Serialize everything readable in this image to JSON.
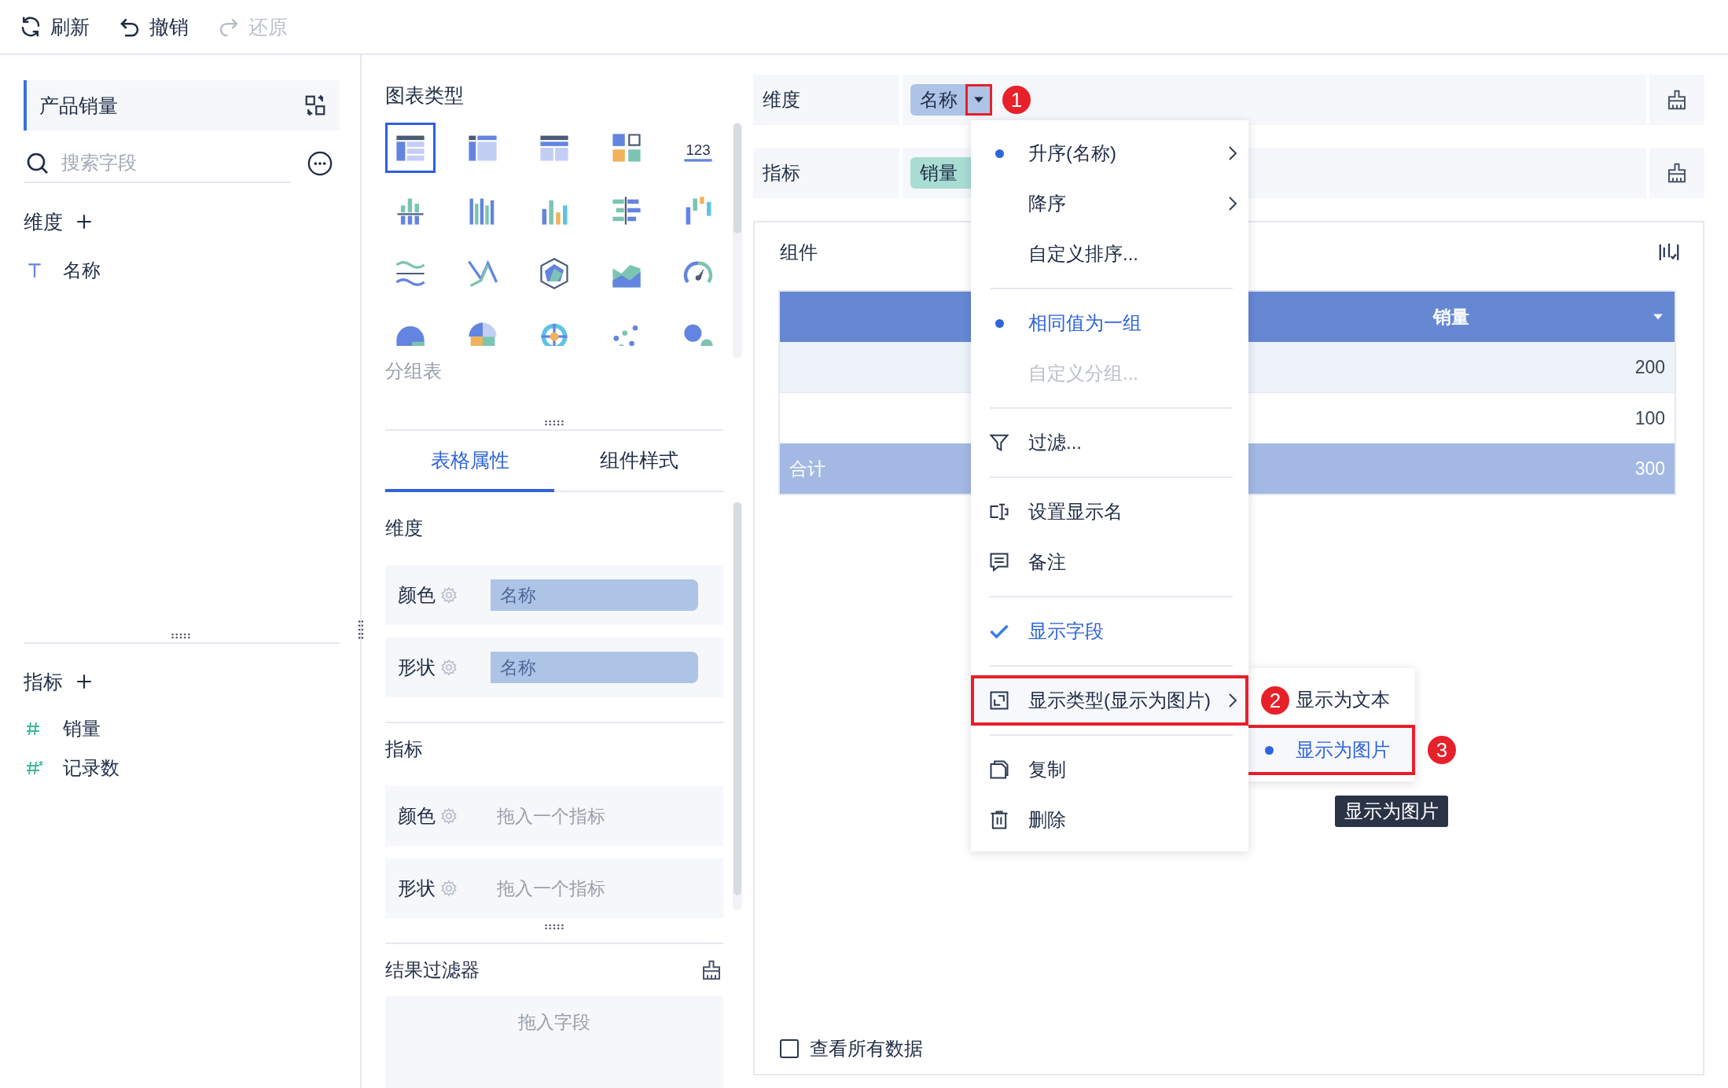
{
  "toolbar": [
    {
      "kind": "refresh",
      "label": "刷新",
      "disabled": false
    },
    {
      "kind": "undo",
      "label": "撤销",
      "disabled": false
    },
    {
      "kind": "redo",
      "label": "还原",
      "disabled": true
    }
  ],
  "data_panel": {
    "title": "产品销量",
    "search": {
      "placeholder": "搜索字段"
    },
    "dimensions": {
      "title": "维度",
      "fields": [
        {
          "kind": "text",
          "label": "名称"
        }
      ]
    },
    "measures": {
      "title": "指标",
      "fields": [
        {
          "kind": "number",
          "label": "销量"
        },
        {
          "kind": "count",
          "label": "记录数"
        }
      ]
    }
  },
  "chart_types": {
    "title": "图表类型",
    "hover_label": "分组表",
    "items": [
      {
        "kind": "group-table",
        "selected": true
      },
      {
        "kind": "cross-table",
        "selected": false
      },
      {
        "kind": "detail-table",
        "selected": false
      },
      {
        "kind": "dashboard",
        "selected": false
      },
      {
        "kind": "number",
        "text": "123",
        "selected": false
      },
      {
        "kind": "stacked-bar",
        "selected": false
      },
      {
        "kind": "grouped-bar",
        "selected": false
      },
      {
        "kind": "bar",
        "selected": false
      },
      {
        "kind": "hbar",
        "selected": false
      },
      {
        "kind": "waterfall",
        "selected": false
      },
      {
        "kind": "wave",
        "selected": false
      },
      {
        "kind": "line",
        "selected": false
      },
      {
        "kind": "radar",
        "selected": false
      },
      {
        "kind": "area",
        "selected": false
      },
      {
        "kind": "gauge",
        "selected": false
      },
      {
        "kind": "half-pie",
        "selected": false
      },
      {
        "kind": "pie",
        "selected": false
      },
      {
        "kind": "rose",
        "selected": false
      },
      {
        "kind": "scatter",
        "selected": false
      },
      {
        "kind": "bubble",
        "selected": false
      }
    ]
  },
  "property_tabs": [
    {
      "label": "表格属性",
      "selected": true
    },
    {
      "label": "组件样式",
      "selected": false
    }
  ],
  "properties": [
    {
      "title": "维度",
      "rows": [
        {
          "label": "颜色",
          "value": "名称"
        },
        {
          "label": "形状",
          "value": "名称"
        }
      ]
    },
    {
      "title": "指标",
      "rows": [
        {
          "label": "颜色",
          "placeholder": "拖入一个指标"
        },
        {
          "label": "形状",
          "placeholder": "拖入一个指标"
        }
      ]
    }
  ],
  "result_filter": {
    "title": "结果过滤器",
    "placeholder": "拖入字段"
  },
  "shelves": [
    {
      "label": "维度",
      "chip": {
        "kind": "dimension",
        "label": "名称",
        "has_menu": true,
        "callout": "1"
      }
    },
    {
      "label": "指标",
      "chip": {
        "kind": "measure",
        "label": "销量",
        "has_menu": false
      }
    }
  ],
  "component": {
    "title": "组件",
    "table": {
      "columns": [
        {
          "label": "销量"
        }
      ],
      "rows": [
        {
          "value": "200"
        },
        {
          "value": "100"
        }
      ],
      "total": {
        "label": "合计",
        "value": "300"
      }
    },
    "view_all": {
      "label": "查看所有数据",
      "checked": false
    }
  },
  "field_menu": {
    "items": [
      {
        "kind": "radio",
        "label": "升序(名称)",
        "selected": true,
        "disabled": false,
        "has_submenu": true
      },
      {
        "kind": "radio",
        "label": "降序",
        "selected": false,
        "disabled": false,
        "has_submenu": true
      },
      {
        "kind": "plain",
        "label": "自定义排序...",
        "disabled": false,
        "has_submenu": false
      },
      {
        "kind": "divider"
      },
      {
        "kind": "radio",
        "label": "相同值为一组",
        "selected": true,
        "disabled": false,
        "has_submenu": false
      },
      {
        "kind": "plain",
        "label": "自定义分组...",
        "disabled": true,
        "has_submenu": false
      },
      {
        "kind": "divider"
      },
      {
        "kind": "filter",
        "label": "过滤...",
        "disabled": false,
        "has_submenu": false
      },
      {
        "kind": "divider"
      },
      {
        "kind": "rename",
        "label": "设置显示名",
        "disabled": false,
        "has_submenu": false
      },
      {
        "kind": "note",
        "label": "备注",
        "disabled": false,
        "has_submenu": false
      },
      {
        "kind": "divider"
      },
      {
        "kind": "toggle",
        "label": "显示字段",
        "checked": true,
        "disabled": false,
        "has_submenu": false
      },
      {
        "kind": "divider"
      },
      {
        "kind": "display",
        "label": "显示类型(显示为图片)",
        "disabled": false,
        "has_submenu": true,
        "callout": "2"
      },
      {
        "kind": "divider"
      },
      {
        "kind": "copy",
        "label": "复制",
        "disabled": false,
        "has_submenu": false
      },
      {
        "kind": "delete",
        "label": "删除",
        "disabled": false,
        "has_submenu": false
      }
    ]
  },
  "submenu": {
    "items": [
      {
        "label": "显示为文本",
        "selected": false
      },
      {
        "label": "显示为图片",
        "selected": true,
        "callout": "3"
      }
    ],
    "tooltip": "显示为图片"
  }
}
